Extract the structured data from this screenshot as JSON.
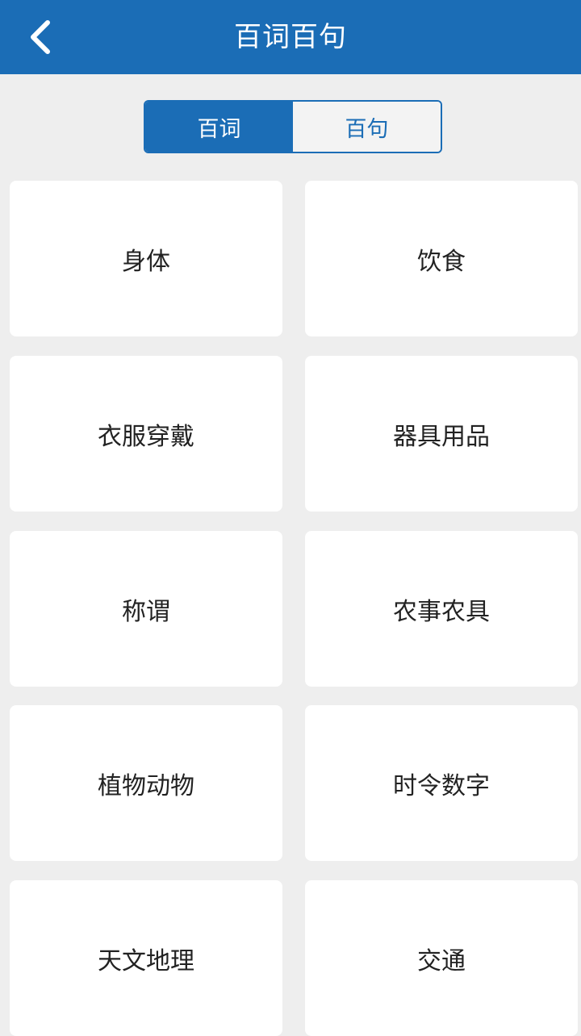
{
  "header": {
    "title": "百词百句",
    "back_icon": "chevron-left-icon"
  },
  "tabs": [
    {
      "label": "百词",
      "selected": true
    },
    {
      "label": "百句",
      "selected": false
    }
  ],
  "categories": [
    {
      "label": "身体"
    },
    {
      "label": "饮食"
    },
    {
      "label": "衣服穿戴"
    },
    {
      "label": "器具用品"
    },
    {
      "label": "称谓"
    },
    {
      "label": "农事农具"
    },
    {
      "label": "植物动物"
    },
    {
      "label": "时令数字"
    },
    {
      "label": "天文地理"
    },
    {
      "label": "交通"
    }
  ],
  "colors": {
    "primary": "#1b6db6",
    "background": "#eeeeee",
    "card": "#ffffff",
    "text": "#222222"
  }
}
